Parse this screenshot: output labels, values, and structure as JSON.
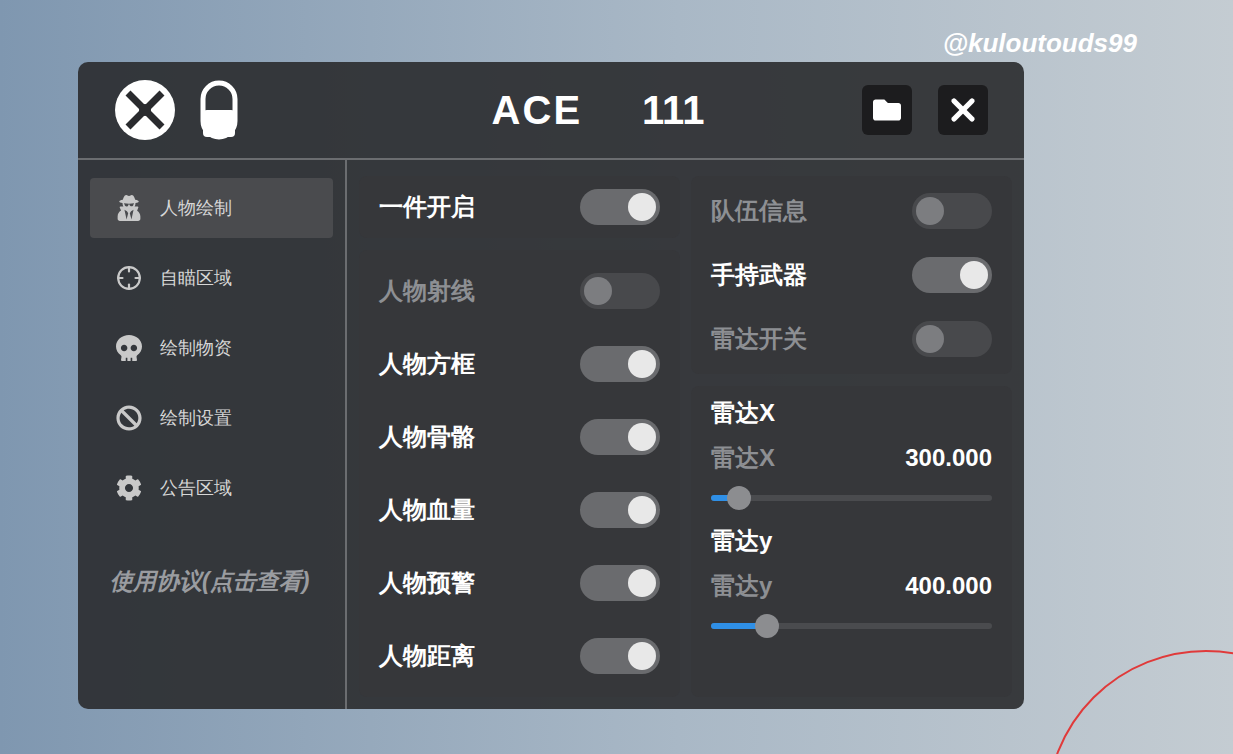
{
  "watermark": "@kuloutouds99",
  "header": {
    "title": "ACE",
    "version": "111"
  },
  "sidebar": {
    "items": [
      {
        "label": "人物绘制",
        "selected": true,
        "icon": "spy"
      },
      {
        "label": "自瞄区域",
        "selected": false,
        "icon": "crosshair"
      },
      {
        "label": "绘制物资",
        "selected": false,
        "icon": "skull"
      },
      {
        "label": "绘制设置",
        "selected": false,
        "icon": "ban"
      },
      {
        "label": "公告区域",
        "selected": false,
        "icon": "gear"
      }
    ],
    "agreement": "使用协议(点击查看)"
  },
  "left_panel": {
    "master": {
      "label": "一件开启",
      "on": true
    },
    "toggles": [
      {
        "label": "人物射线",
        "on": false
      },
      {
        "label": "人物方框",
        "on": true
      },
      {
        "label": "人物骨骼",
        "on": true
      },
      {
        "label": "人物血量",
        "on": true
      },
      {
        "label": "人物预警",
        "on": true
      },
      {
        "label": "人物距离",
        "on": true
      }
    ]
  },
  "right_panel": {
    "toggles": [
      {
        "label": "队伍信息",
        "on": false
      },
      {
        "label": "手持武器",
        "on": true
      },
      {
        "label": "雷达开关",
        "on": false
      }
    ],
    "sliders": [
      {
        "heading": "雷达X",
        "label": "雷达X",
        "reading": "300.000",
        "level": 0.1
      },
      {
        "heading": "雷达y",
        "label": "雷达y",
        "reading": "400.000",
        "level": 0.2
      }
    ]
  }
}
